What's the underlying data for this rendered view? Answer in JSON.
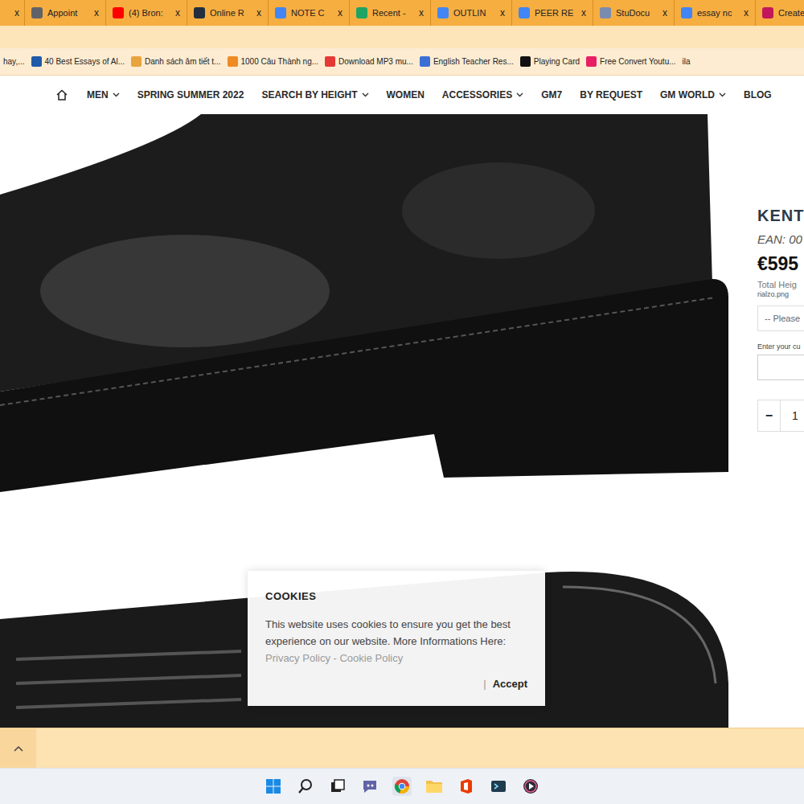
{
  "browser": {
    "partial_tab_close": "x",
    "tabs": [
      {
        "label": "Appoint",
        "close": "x",
        "selected": false,
        "color": "#5f6368"
      },
      {
        "label": "(4) Bron:",
        "close": "x",
        "selected": false,
        "color": "#ff0000"
      },
      {
        "label": "Online R",
        "close": "x",
        "selected": false,
        "color": "#232f3e"
      },
      {
        "label": "NOTE C",
        "close": "x",
        "selected": false,
        "color": "#4285f4"
      },
      {
        "label": "Recent -",
        "close": "x",
        "selected": false,
        "color": "#1fa463"
      },
      {
        "label": "OUTLIN",
        "close": "x",
        "selected": false,
        "color": "#4285f4"
      },
      {
        "label": "PEER RE",
        "close": "x",
        "selected": false,
        "color": "#4285f4"
      },
      {
        "label": "StuDocu",
        "close": "x",
        "selected": false,
        "color": "#7a8bb0"
      },
      {
        "label": "essay nc",
        "close": "x",
        "selected": false,
        "color": "#4285f4"
      },
      {
        "label": "Create",
        "selected": false,
        "color": "#c2185b"
      }
    ],
    "bookmarks": [
      {
        "label": "hay,...",
        "color": ""
      },
      {
        "label": "40 Best Essays of Al...",
        "color": "#1e5aa8"
      },
      {
        "label": "Danh sách âm tiết t...",
        "color": "#e8a33c"
      },
      {
        "label": "1000 Câu Thành ng...",
        "color": "#f08a24"
      },
      {
        "label": "Download MP3 mu...",
        "color": "#e53935"
      },
      {
        "label": "English Teacher Res...",
        "color": "#3b6fd6"
      },
      {
        "label": "Playing Card",
        "color": "#111111"
      },
      {
        "label": "Free Convert Youtu...",
        "color": "#e91e63"
      },
      {
        "label": "ila",
        "color": ""
      }
    ]
  },
  "site": {
    "nav": [
      {
        "label": "MEN",
        "dropdown": true
      },
      {
        "label": "SPRING SUMMER 2022",
        "dropdown": false
      },
      {
        "label": "SEARCH BY HEIGHT",
        "dropdown": true
      },
      {
        "label": "WOMEN",
        "dropdown": false
      },
      {
        "label": "ACCESSORIES",
        "dropdown": true
      },
      {
        "label": "GM7",
        "dropdown": false
      },
      {
        "label": "BY REQUEST",
        "dropdown": false
      },
      {
        "label": "GM WORLD",
        "dropdown": true
      },
      {
        "label": "BLOG",
        "dropdown": false
      }
    ],
    "product": {
      "title": "KENT",
      "ean": "EAN: 00",
      "price": "€595",
      "height_label": "Total Heig",
      "image_name": "rialzo.png",
      "select_placeholder": "-- Please",
      "custom_label": "Enter your cu",
      "minus": "−",
      "quantity": "1"
    },
    "cookie": {
      "title": "COOKIES",
      "body": "This website uses cookies to ensure you get the best experience on our website. More Informations Here:",
      "privacy_link": "Privacy Policy",
      "separator": " - ",
      "cookie_link": "Cookie Policy",
      "accept_separator": "|",
      "accept": "Accept"
    }
  }
}
